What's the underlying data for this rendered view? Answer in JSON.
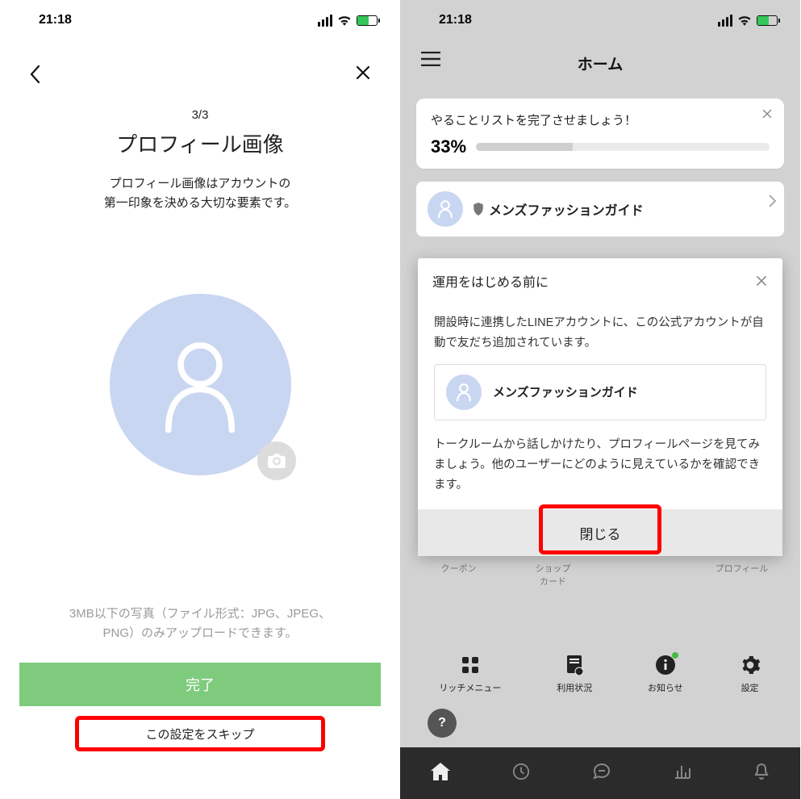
{
  "status": {
    "time": "21:18"
  },
  "left": {
    "step": "3/3",
    "title": "プロフィール画像",
    "subtitle_l1": "プロフィール画像はアカウントの",
    "subtitle_l2": "第一印象を決める大切な要素です。",
    "hint_l1": "3MB以下の写真（ファイル形式：JPG、JPEG、",
    "hint_l2": "PNG）のみアップロードできます。",
    "done": "完了",
    "skip": "この設定をスキップ"
  },
  "right": {
    "home_title": "ホーム",
    "todo_text": "やることリストを完了させましょう！",
    "todo_percent": "33%",
    "account_name": "メンズファッションガイド",
    "modal": {
      "title": "運用をはじめる前に",
      "body1": "開設時に連携したLINEアカウントに、この公式アカウントが自動で友だち追加されています。",
      "friend_name": "メンズファッションガイド",
      "body2": "トークルームから話しかけたり、プロフィールページを見てみましょう。他のユーザーにどのように見えているかを確認できます。",
      "close": "閉じる"
    },
    "partial": {
      "c1": "クーポン",
      "c2_l1": "ショップ",
      "c2_l2": "カード",
      "c4": "プロフィール"
    },
    "menu": {
      "i1": "リッチメニュー",
      "i2": "利用状況",
      "i3": "お知らせ",
      "i4": "設定"
    }
  }
}
